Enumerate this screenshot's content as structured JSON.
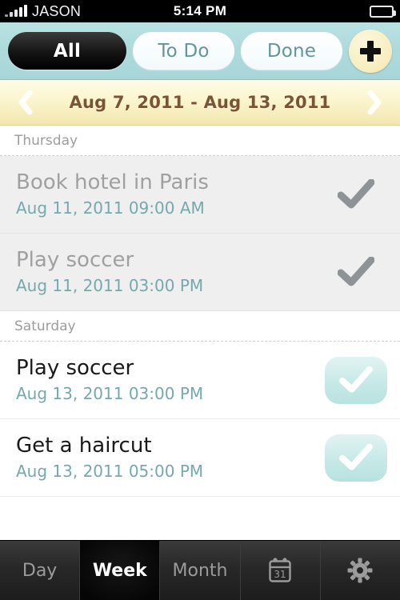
{
  "statusbar": {
    "carrier": "JASON",
    "time": "5:14 PM",
    "signal_icon": "signal-bars-icon",
    "battery_icon": "battery-icon"
  },
  "filterbar": {
    "segments": [
      {
        "label": "All",
        "selected": true
      },
      {
        "label": "To Do",
        "selected": false
      },
      {
        "label": "Done",
        "selected": false
      }
    ],
    "add_button_icon": "plus-icon",
    "background_color": "#aedadc"
  },
  "datebar": {
    "range": "Aug 7, 2011 - Aug 13, 2011",
    "prev_icon": "chevron-left-icon",
    "next_icon": "chevron-right-icon",
    "text_color": "#7a5433"
  },
  "sections": [
    {
      "day": "Thursday",
      "tasks": [
        {
          "title": "Book hotel in Paris",
          "datetime": "Aug 11, 2011 09:00 AM",
          "completed": true,
          "check_icon": "checkmark-icon"
        },
        {
          "title": "Play soccer",
          "datetime": "Aug 11, 2011 03:00 PM",
          "completed": true,
          "check_icon": "checkmark-icon"
        }
      ]
    },
    {
      "day": "Saturday",
      "tasks": [
        {
          "title": "Play soccer",
          "datetime": "Aug 13, 2011 03:00 PM",
          "completed": false,
          "check_icon": "checkmark-icon"
        },
        {
          "title": "Get a haircut",
          "datetime": "Aug 13, 2011 05:00 PM",
          "completed": false,
          "check_icon": "checkmark-icon"
        }
      ]
    }
  ],
  "tabbar": {
    "tabs": [
      {
        "label": "Day",
        "selected": false,
        "icon": null
      },
      {
        "label": "Week",
        "selected": true,
        "icon": null
      },
      {
        "label": "Month",
        "selected": false,
        "icon": null
      },
      {
        "label": "",
        "selected": false,
        "icon": "calendar-31-icon",
        "icon_text": "31"
      },
      {
        "label": "",
        "selected": false,
        "icon": "gear-icon"
      }
    ]
  },
  "colors": {
    "accent_teal": "#74a9ad",
    "checkbox_teal": "#c7e9e7",
    "cream": "#fbf5cf",
    "done_row_bg": "#efefef"
  }
}
